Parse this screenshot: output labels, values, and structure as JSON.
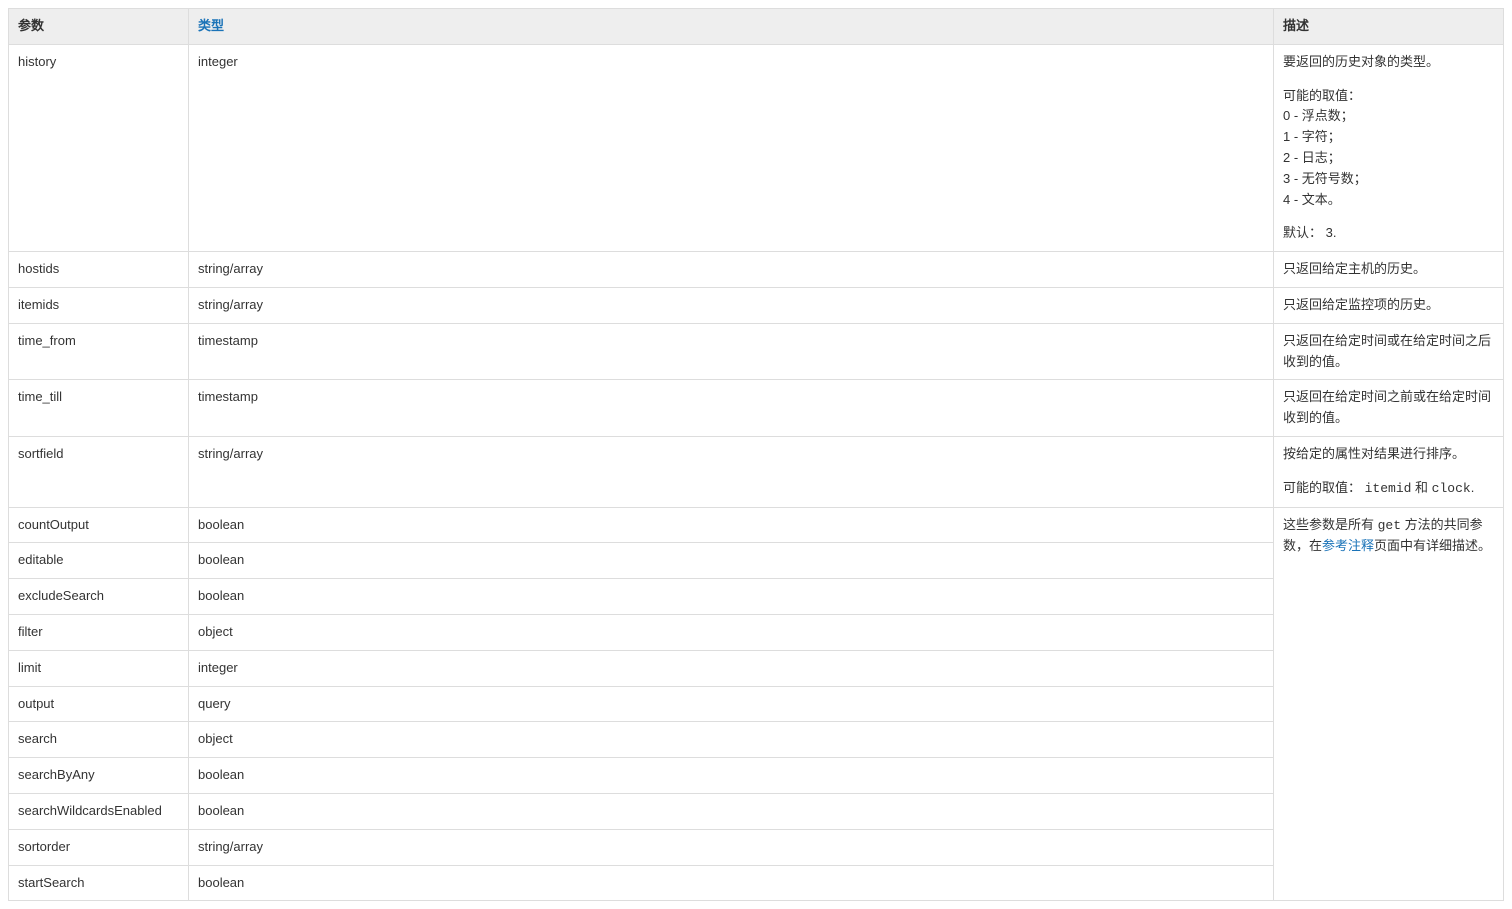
{
  "headers": {
    "param": "参数",
    "type_link": "类型",
    "desc": "描述"
  },
  "rows": {
    "history": {
      "param": "history",
      "type": "integer"
    },
    "hostids": {
      "param": "hostids",
      "type": "string/array",
      "desc": "只返回给定主机的历史。"
    },
    "itemids": {
      "param": "itemids",
      "type": "string/array",
      "desc": "只返回给定监控项的历史。"
    },
    "time_from": {
      "param": "time_from",
      "type": "timestamp",
      "desc": "只返回在给定时间或在给定时间之后收到的值。"
    },
    "time_till": {
      "param": "time_till",
      "type": "timestamp",
      "desc": "只返回在给定时间之前或在给定时间收到的值。"
    },
    "sortfield": {
      "param": "sortfield",
      "type": "string/array"
    },
    "countOutput": {
      "param": "countOutput",
      "type": "boolean"
    },
    "editable": {
      "param": "editable",
      "type": "boolean"
    },
    "excludeSearch": {
      "param": "excludeSearch",
      "type": "boolean"
    },
    "filter": {
      "param": "filter",
      "type": "object"
    },
    "limit": {
      "param": "limit",
      "type": "integer"
    },
    "output": {
      "param": "output",
      "type": "query"
    },
    "search": {
      "param": "search",
      "type": "object"
    },
    "searchByAny": {
      "param": "searchByAny",
      "type": "boolean"
    },
    "searchWildcardsEnabled": {
      "param": "searchWildcardsEnabled",
      "type": "boolean"
    },
    "sortorder": {
      "param": "sortorder",
      "type": "string/array"
    },
    "startSearch": {
      "param": "startSearch",
      "type": "boolean"
    }
  },
  "history_desc": {
    "l1": "要返回的历史对象的类型。",
    "l2": "可能的取值：",
    "v0": "0 - 浮点数；",
    "v1": "1 - 字符；",
    "v2": "2 - 日志；",
    "v3": "3 - 无符号数；",
    "v4": "4 - 文本。",
    "def": "默认： 3."
  },
  "sortfield_desc": {
    "l1": "按给定的属性对结果进行排序。",
    "l2_prefix": "可能的取值： ",
    "code1": "itemid",
    "and_txt": " 和 ",
    "code2": "clock",
    "period": "."
  },
  "common_desc": {
    "prefix": "这些参数是所有 ",
    "code_get": "get",
    "mid": " 方法的共同参数，在",
    "link_text": "参考注释",
    "suffix": "页面中有详细描述。"
  }
}
